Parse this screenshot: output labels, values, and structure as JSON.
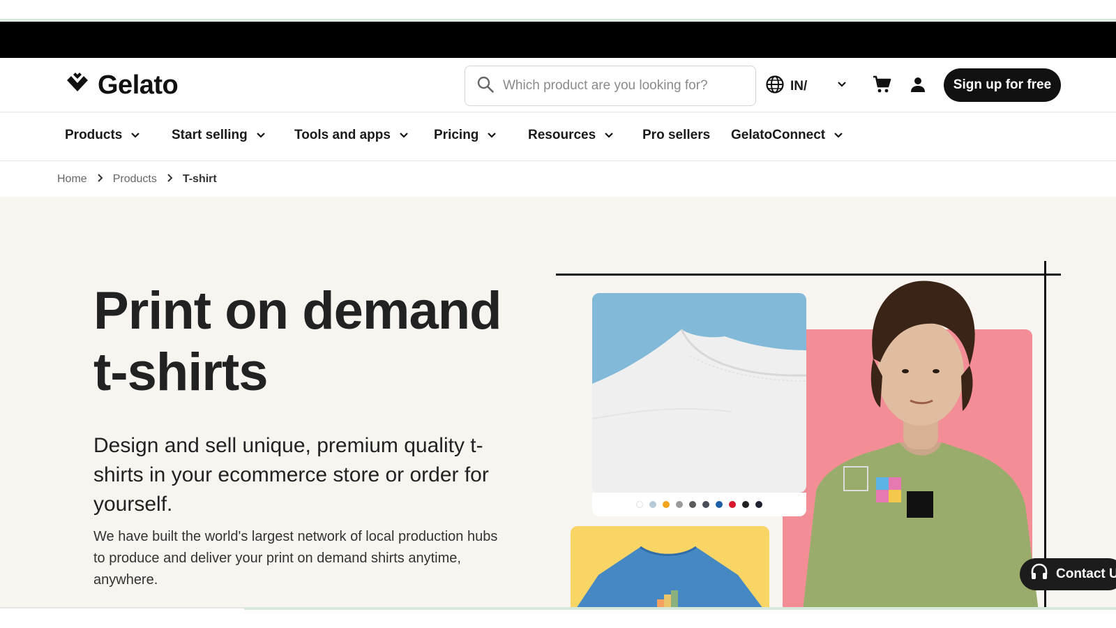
{
  "header": {
    "logo_text": "Gelato",
    "search_placeholder": "Which product are you looking for?",
    "region_label": "IN/",
    "signup_label": "Sign up for free"
  },
  "nav": {
    "items": [
      {
        "label": "Products",
        "has_dropdown": true
      },
      {
        "label": "Start selling",
        "has_dropdown": true
      },
      {
        "label": "Tools and apps",
        "has_dropdown": true
      },
      {
        "label": "Pricing",
        "has_dropdown": true
      },
      {
        "label": "Resources",
        "has_dropdown": true
      },
      {
        "label": "Pro sellers",
        "has_dropdown": false
      },
      {
        "label": "GelatoConnect",
        "has_dropdown": true
      }
    ]
  },
  "breadcrumb": {
    "items": [
      "Home",
      "Products",
      "T-shirt"
    ]
  },
  "hero": {
    "title": "Print on demand t-shirts",
    "subtitle": "Design and sell unique, premium quality t-shirts in your ecommerce store or order for yourself.",
    "body": "We have built the world's largest network of local production hubs to produce and deliver your print on demand shirts anytime, anywhere.",
    "color_swatches": [
      "#ffffff",
      "#b8c9d8",
      "#f2a51a",
      "#9a9a9a",
      "#5a5a5a",
      "#4a4f5a",
      "#1f5fa8",
      "#d8182e",
      "#222222",
      "#1e2233"
    ]
  },
  "contact": {
    "label": "Contact U"
  },
  "colors": {
    "accent_dark": "#111111",
    "hero_bg": "#f8f4ef",
    "divider_green": "#d6e8d9",
    "card_blue": "#82b9d8",
    "card_yellow": "#f9d565",
    "card_pink": "#f48e96",
    "shirt_green": "#9aac6c"
  }
}
